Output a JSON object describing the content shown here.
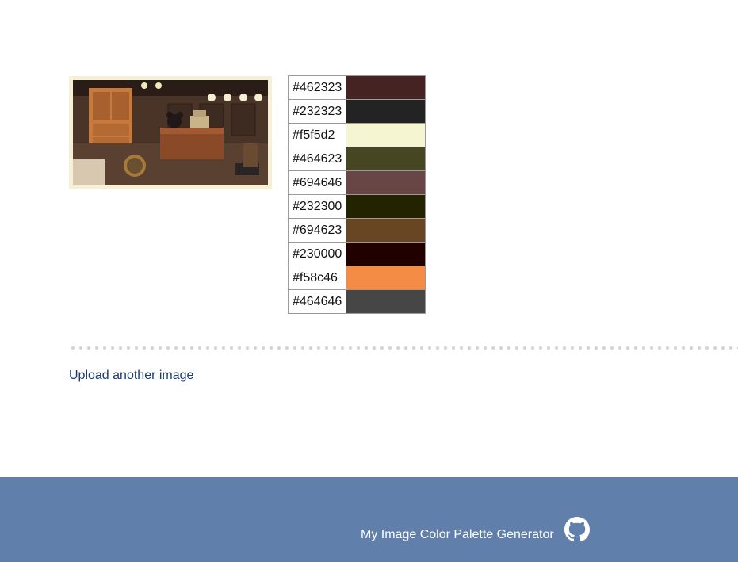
{
  "palette": {
    "rows": [
      {
        "hex": "#462323",
        "color": "#462323"
      },
      {
        "hex": "#232323",
        "color": "#232323"
      },
      {
        "hex": "#f5f5d2",
        "color": "#f5f5d2"
      },
      {
        "hex": "#464623",
        "color": "#464623"
      },
      {
        "hex": "#694646",
        "color": "#694646"
      },
      {
        "hex": "#232300",
        "color": "#232300"
      },
      {
        "hex": "#694623",
        "color": "#694623"
      },
      {
        "hex": "#230000",
        "color": "#230000"
      },
      {
        "hex": "#f58c46",
        "color": "#f58c46"
      },
      {
        "hex": "#464646",
        "color": "#464646"
      }
    ]
  },
  "upload_link": "Upload another image",
  "footer": {
    "text": "My Image Color Palette Generator",
    "icon": "github-icon"
  },
  "colors": {
    "footer_bg": "#607fab",
    "link": "#1f3a6b",
    "thumb_frame": "#f5f0d6"
  }
}
